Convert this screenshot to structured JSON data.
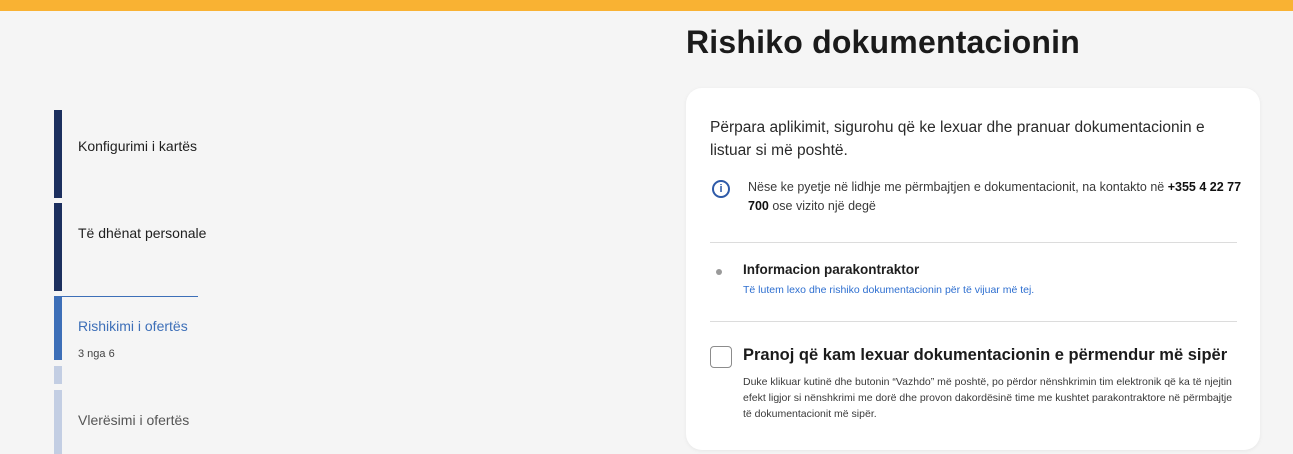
{
  "colors": {
    "accent_top": "#f9b233",
    "step_done": "#1c2f5e",
    "step_active": "#3d6fb8",
    "step_pending": "#c3cee3",
    "link": "#2e6fd0"
  },
  "header": {
    "title": "Rishiko dokumentacionin"
  },
  "stepper": {
    "steps": [
      {
        "label": "Konfigurimi i kartës",
        "state": "done"
      },
      {
        "label": "Të dhënat personale",
        "state": "done"
      },
      {
        "label": "Rishikimi i ofertës",
        "state": "active",
        "sub": "3 nga 6"
      },
      {
        "label": "Vlerësimi i ofertës",
        "state": "pending"
      }
    ]
  },
  "card": {
    "intro": "Përpara aplikimit, sigurohu që ke lexuar dhe pranuar dokumentacionin e listuar si më poshtë.",
    "info_icon": "info-icon",
    "info_text_1": "Nëse ke pyetje në lidhje me përmbajtjen e dokumentacionit, na kontakto në ",
    "info_phone": "+355 4 22 77 700",
    "info_text_2": " ose vizito një degë",
    "document": {
      "title": "Informacion parakontraktor",
      "link": "Të lutem lexo dhe rishiko dokumentacionin për të vijuar më tej."
    },
    "accept": {
      "title": "Pranoj që kam lexuar dokumentacionin e përmendur më sipër",
      "description": "Duke klikuar kutinë dhe butonin “Vazhdo” më poshtë, po përdor nënshkrimin tim elektronik që ka të njejtin efekt ligjor si nënshkrimi me dorë dhe provon dakordësinë time me kushtet parakontraktore në përmbajtje të dokumentacionit më sipër."
    }
  }
}
